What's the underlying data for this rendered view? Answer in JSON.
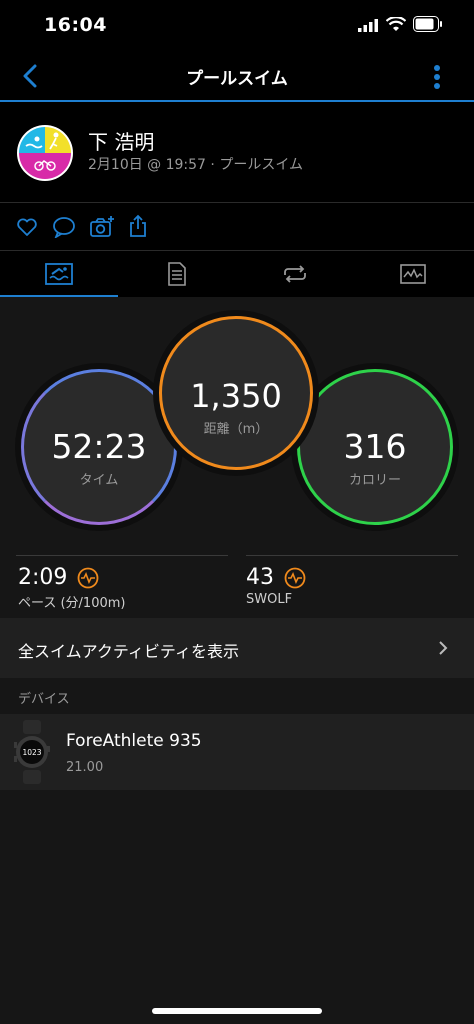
{
  "status_bar": {
    "time": "16:04"
  },
  "nav": {
    "title": "プールスイム"
  },
  "profile": {
    "name": "下 浩明",
    "subtitle": "2月10日 @ 19:57 · プールスイム"
  },
  "metrics": {
    "time": {
      "value": "52:23",
      "label": "タイム"
    },
    "distance": {
      "value": "1,350",
      "label": "距離（m）"
    },
    "calories": {
      "value": "316",
      "label": "カロリー"
    }
  },
  "stats": {
    "pace": {
      "value": "2:09",
      "label": "ペース (分/100m)"
    },
    "swolf": {
      "value": "43",
      "label": "SWOLF"
    }
  },
  "all_swims": {
    "label": "全スイムアクティビティを表示"
  },
  "devices": {
    "section_label": "デバイス",
    "device_name": "ForeAthlete 935",
    "device_version": "21.00",
    "watch_face_time": "1023"
  },
  "colors": {
    "accent": "#1e7fd0",
    "time_ring": "#5b7fe0",
    "distance_ring": "#f08a1c",
    "calories_ring": "#2ed24a"
  }
}
